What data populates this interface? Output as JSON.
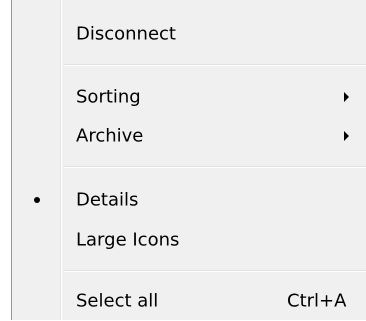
{
  "menu": {
    "items": [
      {
        "label": "Disconnect"
      },
      {
        "label": "Sorting"
      },
      {
        "label": "Archive"
      },
      {
        "label": "Details"
      },
      {
        "label": "Large Icons"
      },
      {
        "label": "Select all",
        "shortcut": "Ctrl+A"
      }
    ]
  }
}
